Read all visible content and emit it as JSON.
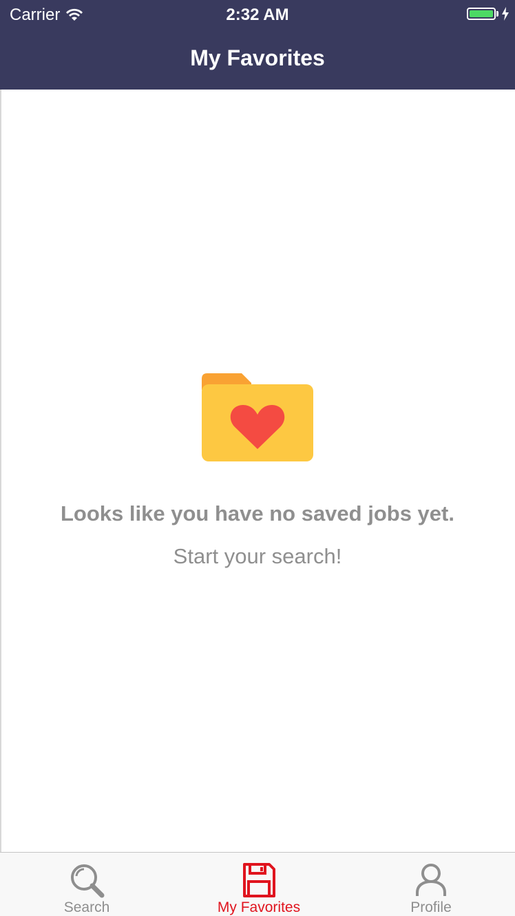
{
  "status_bar": {
    "carrier": "Carrier",
    "time": "2:32 AM",
    "battery_color": "#4cd964"
  },
  "nav": {
    "title": "My Favorites",
    "background": "#393a5e"
  },
  "empty_state": {
    "icon": "folder-heart-icon",
    "title": "Looks like you have no saved jobs yet.",
    "subtitle": "Start your search!"
  },
  "tabbar": {
    "active_color": "#e0141e",
    "inactive_color": "#8e8e8e",
    "tabs": [
      {
        "label": "Search",
        "icon": "search-icon",
        "active": false
      },
      {
        "label": "My Favorites",
        "icon": "floppy-disk-icon",
        "active": true
      },
      {
        "label": "Profile",
        "icon": "person-icon",
        "active": false
      }
    ]
  }
}
